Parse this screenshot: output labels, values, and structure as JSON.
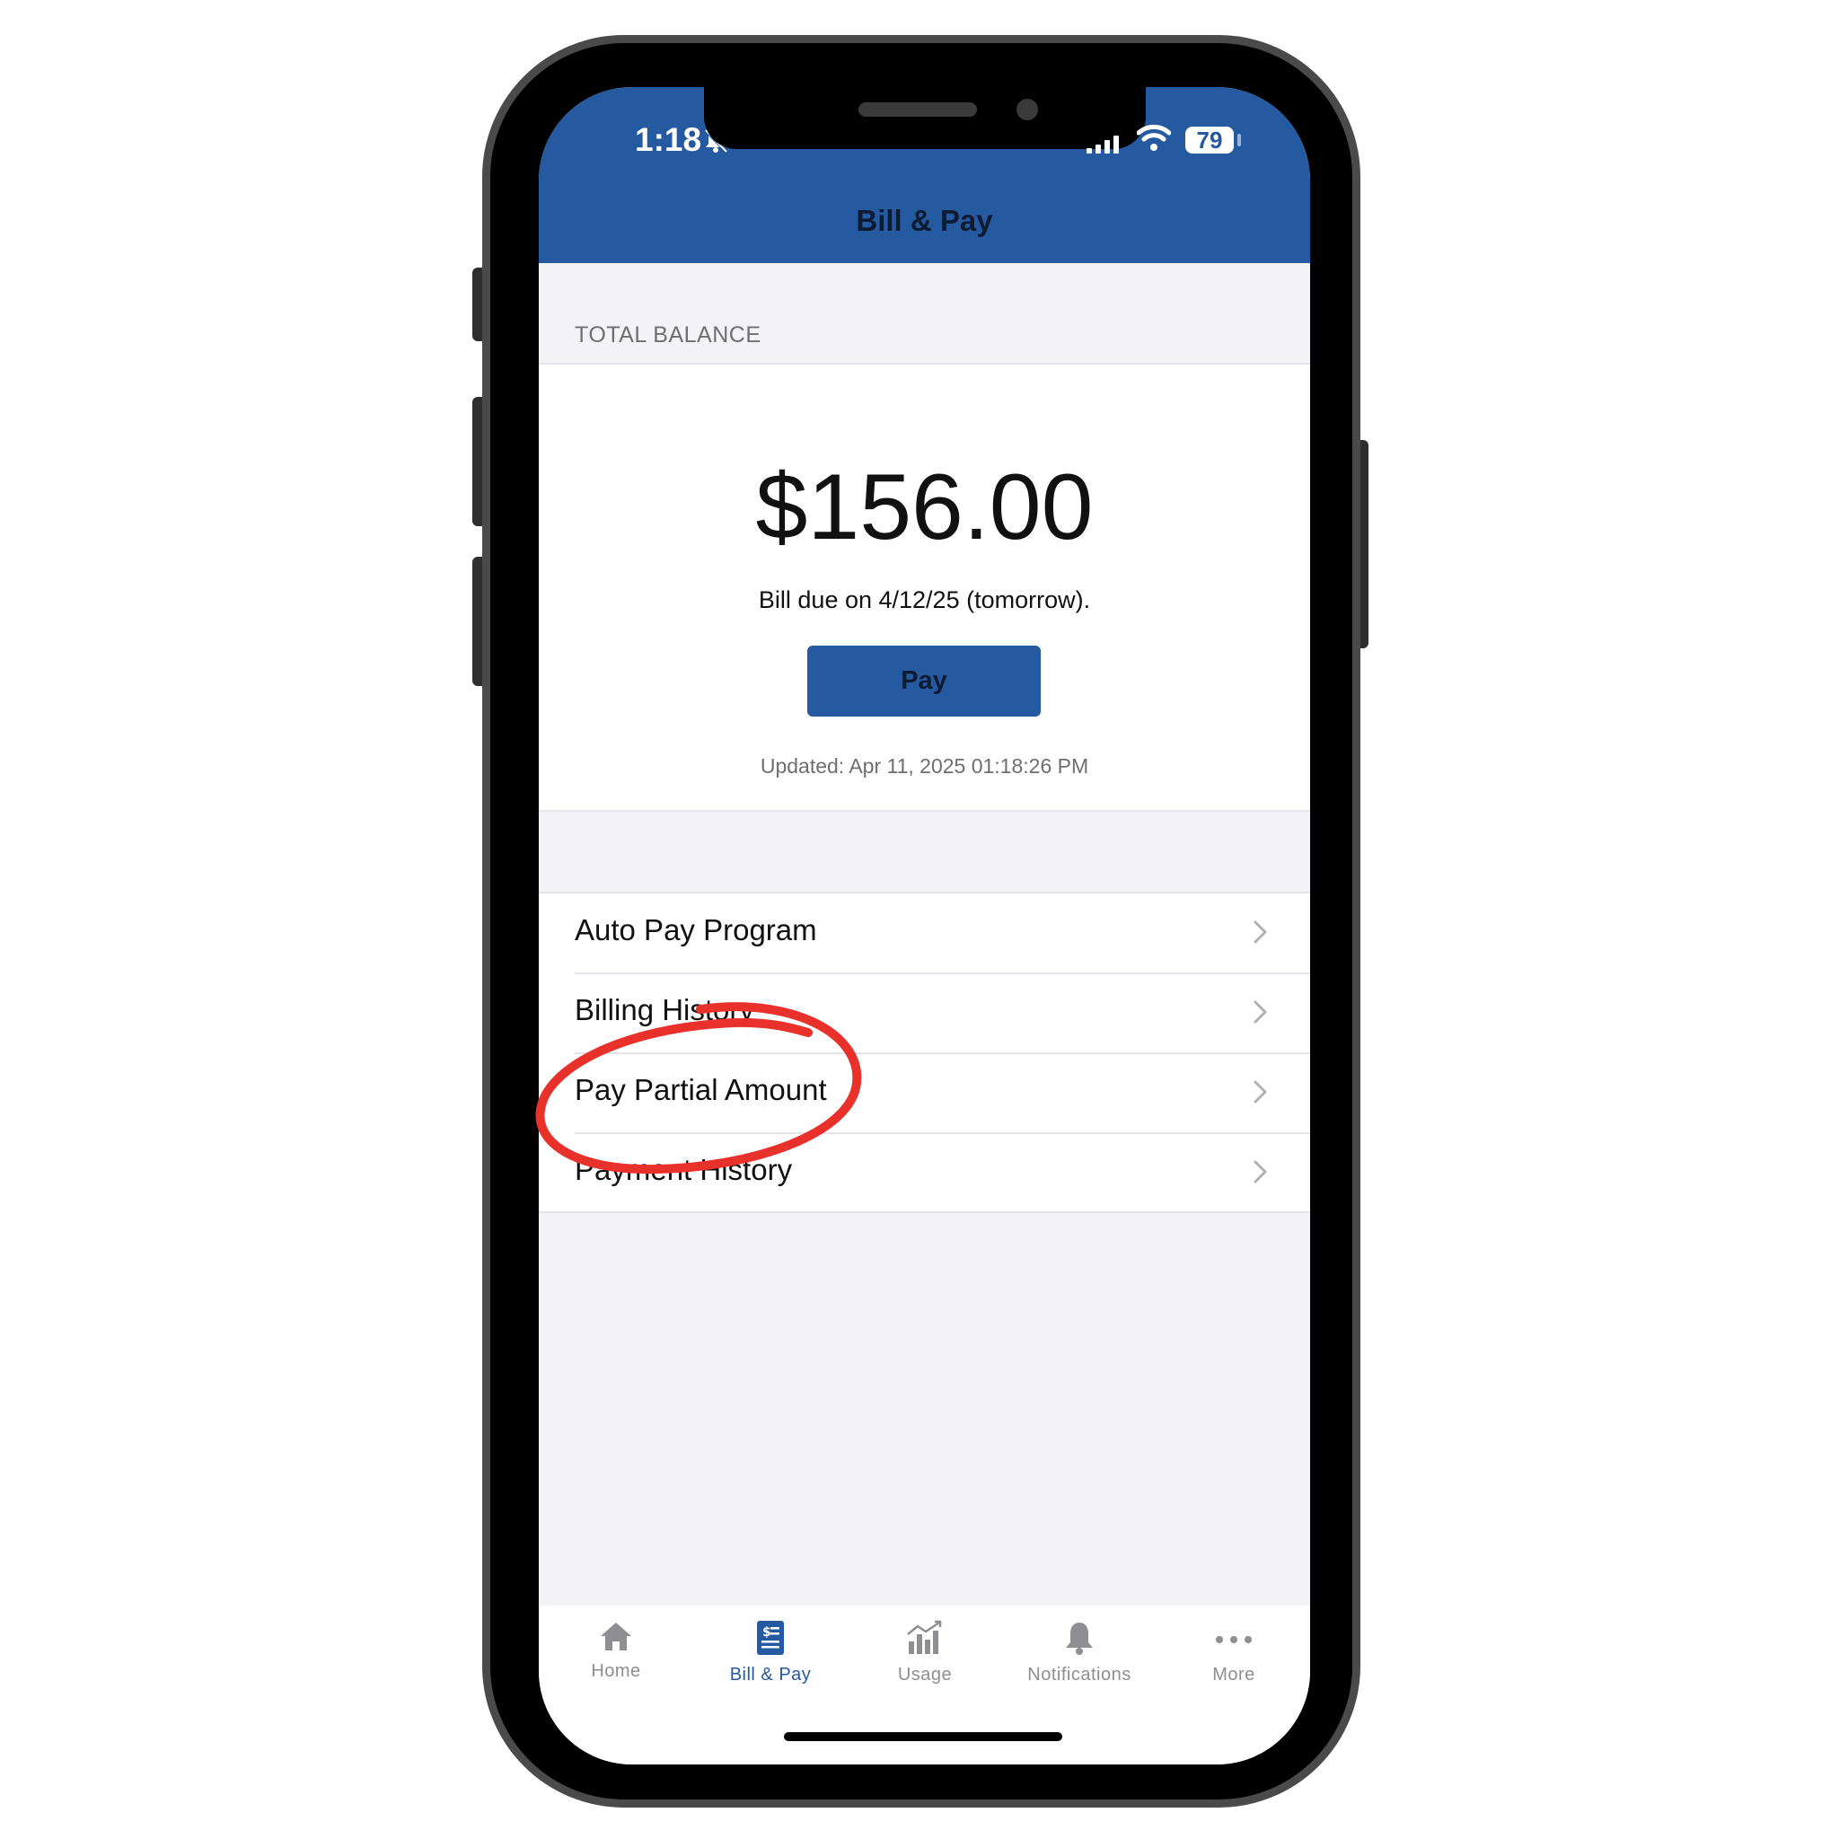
{
  "status_bar": {
    "time": "1:18",
    "battery": "79"
  },
  "header": {
    "title": "Bill & Pay"
  },
  "balance": {
    "section_label": "TOTAL BALANCE",
    "amount": "$156.00",
    "due_text": "Bill due on 4/12/25 (tomorrow).",
    "pay_label": "Pay",
    "updated_text": "Updated: Apr 11, 2025 01:18:26 PM"
  },
  "menu": {
    "items": [
      {
        "label": "Auto Pay Program"
      },
      {
        "label": "Billing History"
      },
      {
        "label": "Pay Partial Amount"
      },
      {
        "label": "Payment History"
      }
    ]
  },
  "tabbar": {
    "items": [
      {
        "label": "Home",
        "icon": "home-icon"
      },
      {
        "label": "Bill & Pay",
        "icon": "bill-icon",
        "active": true
      },
      {
        "label": "Usage",
        "icon": "usage-chart-icon"
      },
      {
        "label": "Notifications",
        "icon": "bell-icon"
      },
      {
        "label": "More",
        "icon": "more-dots-icon"
      }
    ]
  },
  "colors": {
    "brand_blue": "#2559a0",
    "annotation_red": "#e8312a",
    "background": "#f2f2f7"
  }
}
